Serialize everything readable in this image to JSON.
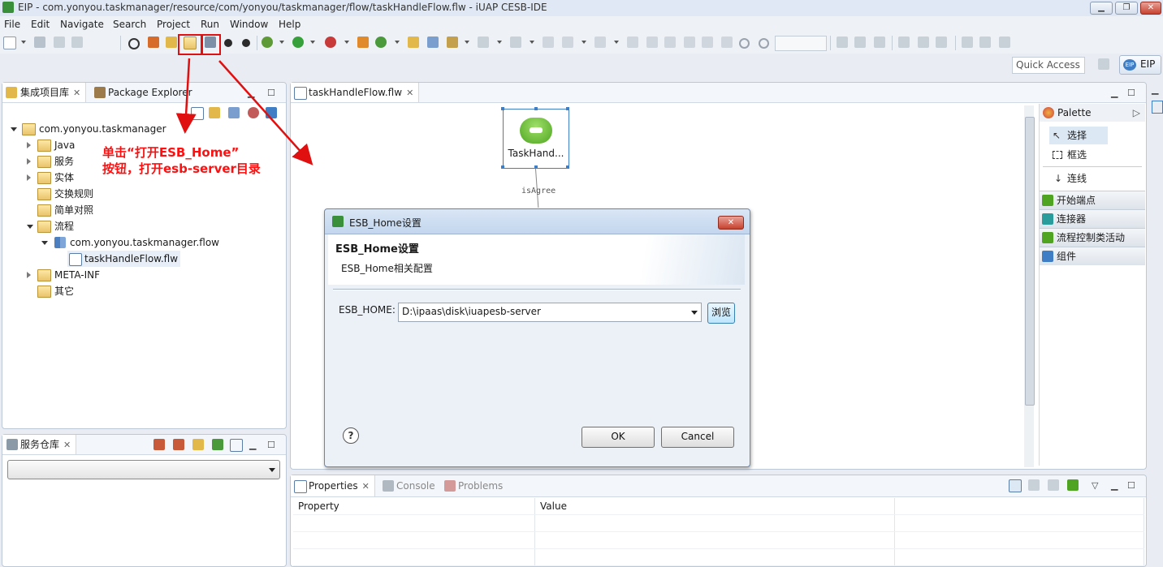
{
  "window": {
    "title": "EIP - com.yonyou.taskmanager/resource/com/yonyou/taskmanager/flow/taskHandleFlow.flw - iUAP CESB-IDE",
    "controls": [
      "▁",
      "❐",
      "✕"
    ]
  },
  "menu": [
    "File",
    "Edit",
    "Navigate",
    "Search",
    "Project",
    "Run",
    "Window",
    "Help"
  ],
  "quick_access": {
    "placeholder": "Quick Access"
  },
  "perspective": {
    "label": "EIP",
    "badge": "EIP"
  },
  "left_panel": {
    "tabs": [
      {
        "label": "集成项目库",
        "active": true
      },
      {
        "label": "Package Explorer",
        "active": false
      }
    ],
    "tree": {
      "root": "com.yonyou.taskmanager",
      "items": [
        {
          "label": "Java",
          "expandable": true
        },
        {
          "label": "服务",
          "expandable": true
        },
        {
          "label": "实体",
          "expandable": true
        },
        {
          "label": "交换规则",
          "expandable": false
        },
        {
          "label": "简单对照",
          "expandable": false
        },
        {
          "label": "流程",
          "expanded": true
        },
        {
          "label": "com.yonyou.taskmanager.flow",
          "expanded": true
        },
        {
          "label": "taskHandleFlow.flw",
          "selected": true
        },
        {
          "label": "META-INF",
          "expandable": true
        },
        {
          "label": "其它",
          "expandable": false
        }
      ]
    }
  },
  "service_panel": {
    "tab": "服务仓库",
    "select_value": ""
  },
  "editor": {
    "tab": "taskHandleFlow.flw",
    "node_label": "TaskHand...",
    "edge_label": "isAgree"
  },
  "palette": {
    "title": "Palette",
    "tools": [
      "选择",
      "框选",
      "连线"
    ],
    "categories": [
      "开始端点",
      "连接器",
      "流程控制类活动",
      "组件"
    ]
  },
  "annotation": {
    "line1": "单击“打开ESB_Home”",
    "line2": "按钮，打开esb-server目录"
  },
  "dialog": {
    "title": "ESB_Home设置",
    "heading": "ESB_Home设置",
    "description": "ESB_Home相关配置",
    "field_label": "ESB_HOME:",
    "field_value": "D:\\ipaas\\disk\\iuapesb-server",
    "browse": "浏览",
    "ok": "OK",
    "cancel": "Cancel",
    "help": "?"
  },
  "bottom_panel": {
    "tabs": [
      "Properties",
      "Console",
      "Problems"
    ],
    "columns": [
      "Property",
      "Value"
    ]
  },
  "colors": {
    "accent": "#3f7dc4",
    "annotation_red": "#ff1010",
    "node_green": "#5cb531"
  }
}
